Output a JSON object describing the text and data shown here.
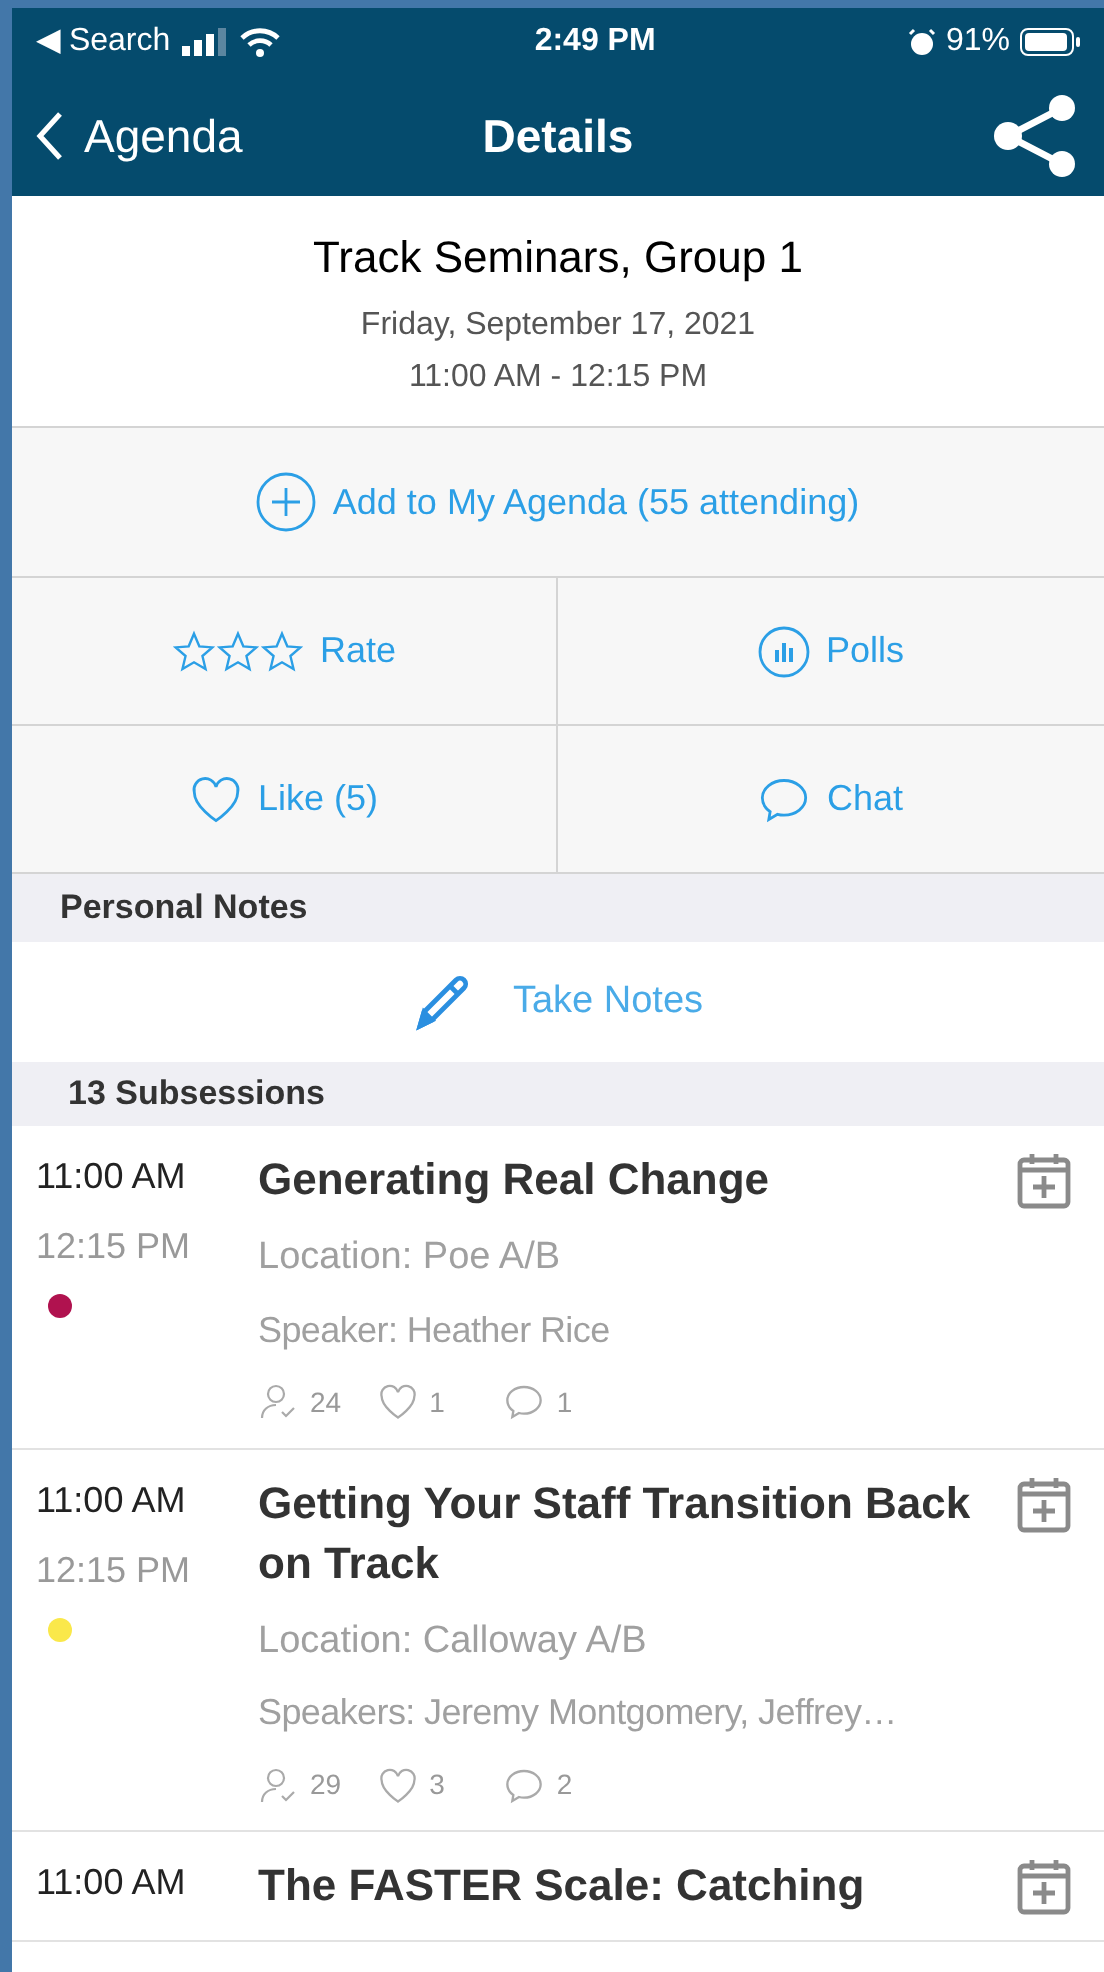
{
  "status_bar": {
    "back_label": "◀ Search",
    "time": "2:49 PM",
    "battery": "91%"
  },
  "nav": {
    "back": "Agenda",
    "title": "Details"
  },
  "session": {
    "title": "Track Seminars, Group 1",
    "date": "Friday, September 17, 2021",
    "time": "11:00 AM - 12:15 PM"
  },
  "add_button": "Add to My Agenda (55 attending)",
  "actions": [
    {
      "kind": "rate",
      "label": "Rate",
      "stars": 0
    },
    {
      "kind": "polls",
      "label": "Polls"
    },
    {
      "kind": "like",
      "label": "Like (5)"
    },
    {
      "kind": "chat",
      "label": "Chat"
    }
  ],
  "notes_section": {
    "header": "Personal Notes",
    "button": "Take Notes"
  },
  "subsessions_header": "13 Subsessions",
  "subsessions": [
    {
      "start": "11:00 AM",
      "end": "12:15 PM",
      "color": "#b0124f",
      "title": "Generating Real Change",
      "location": "Location: Poe A/B",
      "speaker": "Speaker: Heather Rice",
      "attendees": "24",
      "likes": "1",
      "comments": "1"
    },
    {
      "start": "11:00 AM",
      "end": "12:15 PM",
      "color": "#fae84a",
      "title": "Getting Your Staff Transition Back on Track",
      "location": "Location: Calloway A/B",
      "speaker": "Speakers: Jeremy Montgomery, Jeffrey…",
      "attendees": "29",
      "likes": "3",
      "comments": "2"
    },
    {
      "start": "11:00 AM",
      "title": "The FASTER Scale: Catching"
    }
  ]
}
